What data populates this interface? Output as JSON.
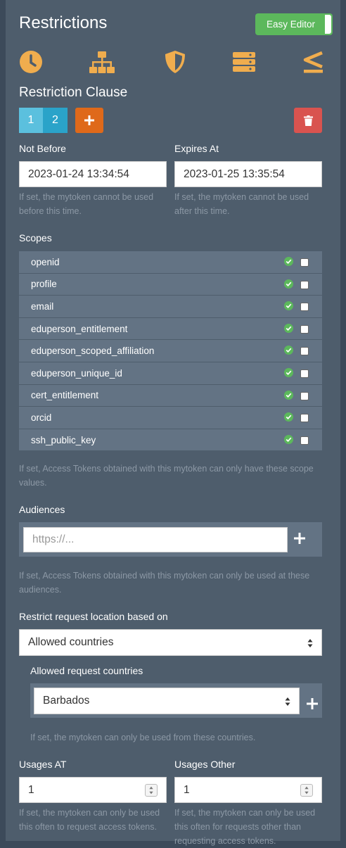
{
  "header": {
    "title": "Restrictions",
    "easy_editor_label": "Easy Editor"
  },
  "icons": [
    "clock-icon",
    "network-icon",
    "shield-icon",
    "server-icon",
    "less-than-equal-icon"
  ],
  "clause": {
    "title": "Restriction Clause",
    "tabs": [
      "1",
      "2"
    ]
  },
  "not_before": {
    "label": "Not Before",
    "value": "2023-01-24 13:34:54",
    "help": "If set, the mytoken cannot be used before this time."
  },
  "expires_at": {
    "label": "Expires At",
    "value": "2023-01-25 13:35:54",
    "help": "If set, the mytoken cannot be used after this time."
  },
  "scopes": {
    "label": "Scopes",
    "items": [
      "openid",
      "profile",
      "email",
      "eduperson_entitlement",
      "eduperson_scoped_affiliation",
      "eduperson_unique_id",
      "cert_entitlement",
      "orcid",
      "ssh_public_key"
    ],
    "help": "If set, Access Tokens obtained with this mytoken can only have these scope values."
  },
  "audiences": {
    "label": "Audiences",
    "placeholder": "https://...",
    "help": "If set, Access Tokens obtained with this mytoken can only be used at these audiences."
  },
  "location": {
    "label": "Restrict request location based on",
    "selected": "Allowed countries"
  },
  "countries": {
    "label": "Allowed request countries",
    "selected": "Barbados",
    "help": "If set, the mytoken can only be used from these countries."
  },
  "usages_at": {
    "label": "Usages AT",
    "value": "1",
    "help": "If set, the mytoken can only be used this often to request access tokens."
  },
  "usages_other": {
    "label": "Usages Other",
    "value": "1",
    "help": "If set, the mytoken can only be used this often for requests other than requesting access tokens."
  },
  "colors": {
    "accent": "#f0ad4e",
    "primary": "#df691a",
    "success": "#5cb85c",
    "danger": "#d9534f",
    "info": "#5bc0de"
  }
}
